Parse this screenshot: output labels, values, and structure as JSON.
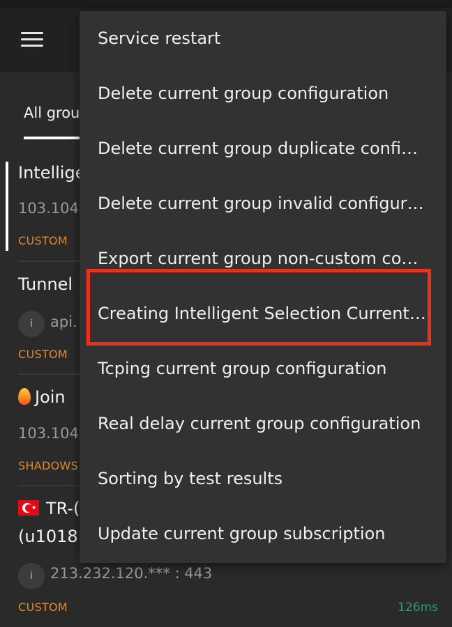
{
  "tabs": [
    {
      "label": "All grou"
    }
  ],
  "list": [
    {
      "title": "Intellige",
      "address": "103.104",
      "tag": "CUSTOM"
    },
    {
      "title": "Tunnel",
      "address": "api.",
      "tag": "CUSTOM",
      "info_icon": "i"
    },
    {
      "title": "Join",
      "address": "103.104",
      "tag": "SHADOWS"
    },
    {
      "title": "TR-(",
      "title_line2": "(u1018",
      "address": "213.232.120.*** : 443",
      "tag": "CUSTOM",
      "info_icon": "i",
      "delay": "126ms"
    }
  ],
  "menu": {
    "items": [
      {
        "label": "Service restart"
      },
      {
        "label": "Delete current group configuration"
      },
      {
        "label": "Delete current group duplicate configuration"
      },
      {
        "label": "Delete current group invalid configuration"
      },
      {
        "label": "Export current group non-custom configuration"
      },
      {
        "label": "Creating Intelligent Selection Current Group"
      },
      {
        "label": "Tcping current group configuration"
      },
      {
        "label": "Real delay current group configuration"
      },
      {
        "label": "Sorting by test results"
      },
      {
        "label": "Update current group subscription"
      }
    ]
  },
  "colors": {
    "tag": "#e08a2c",
    "delay": "#2e9e6a",
    "highlight": "#e8321e",
    "accent_stroke": "#ff7a3d"
  },
  "icons": {
    "menu": "hamburger-icon",
    "info": "info-icon",
    "flag": "turkey-flag-icon",
    "fire": "fire-icon"
  }
}
